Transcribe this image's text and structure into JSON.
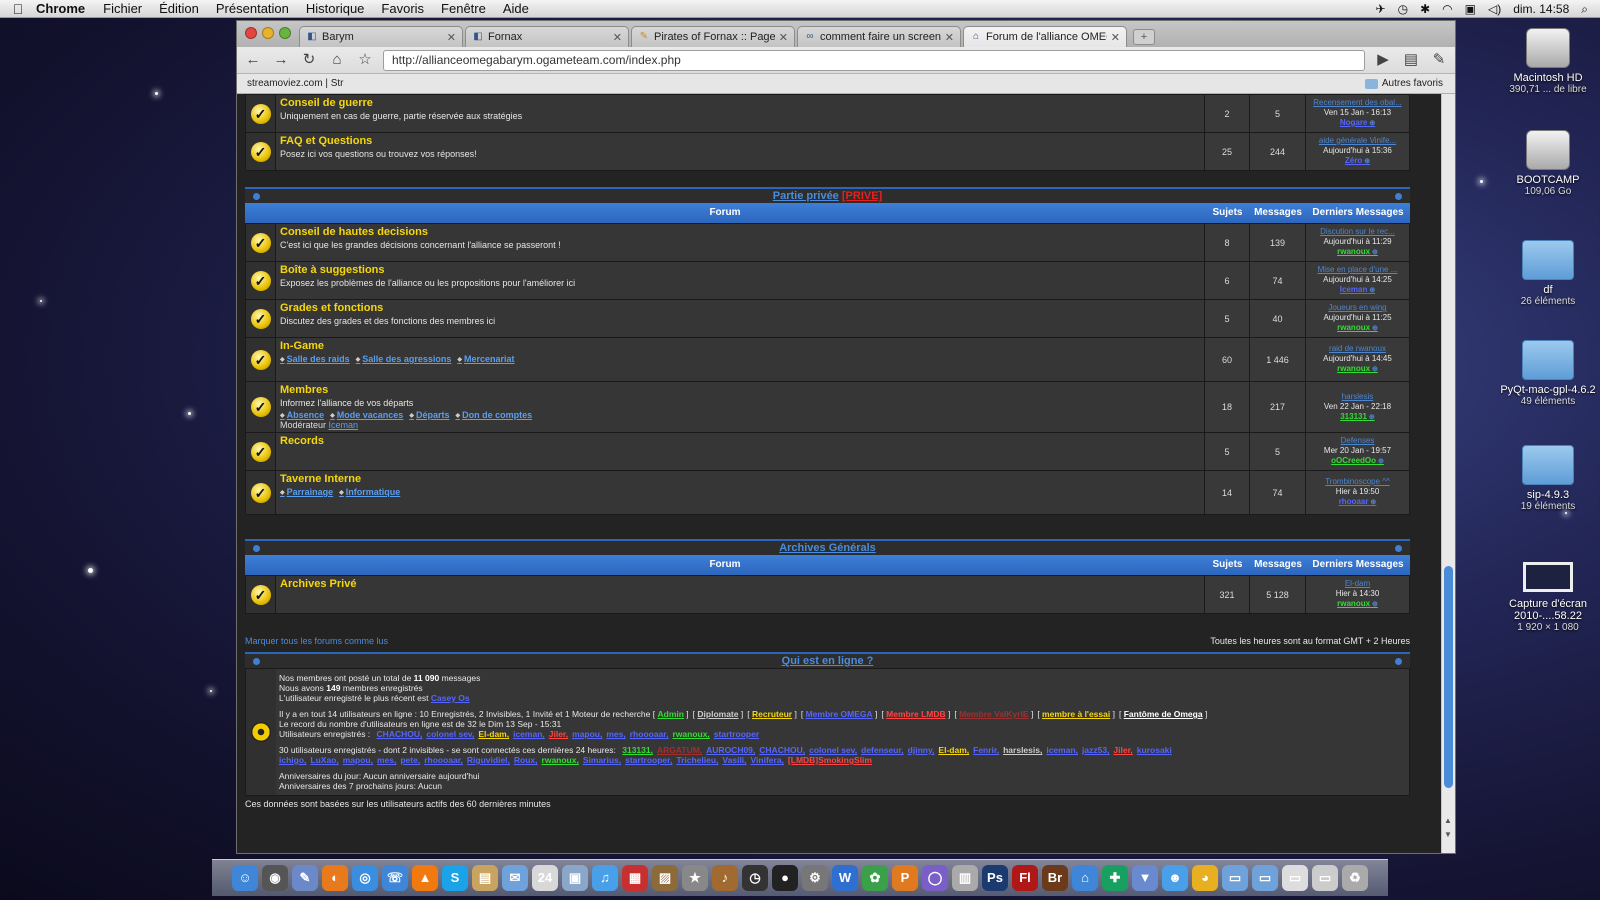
{
  "menubar": {
    "apple": "",
    "app": "Chrome",
    "items": [
      "Fichier",
      "Édition",
      "Présentation",
      "Historique",
      "Favoris",
      "Fenêtre",
      "Aide"
    ],
    "clock": "dim. 14:58"
  },
  "browser": {
    "tabs": [
      {
        "label": "Barym",
        "active": false
      },
      {
        "label": "Fornax",
        "active": false
      },
      {
        "label": "Pirates of Fornax :: Page de l",
        "active": false
      },
      {
        "label": "comment faire un screen sho",
        "active": false
      },
      {
        "label": "Forum de l'alliance OMEGA",
        "active": true
      }
    ],
    "url": "http://allianceomegabarym.ogameteam.com/index.php",
    "bookmark": "streamoviez.com | Str",
    "other_bookmarks": "Autres favoris"
  },
  "forum": {
    "col_forum": "Forum",
    "col_subjects": "Sujets",
    "col_messages": "Messages",
    "col_last": "Derniers Messages",
    "top_rows": [
      {
        "title": "Conseil de guerre",
        "desc": "Uniquement en cas de guerre, partie réservée aux stratégies",
        "subjects": "2",
        "messages": "5",
        "last_topic": "Recensement des obal...",
        "last_date": "Ven 15 Jan - 16:13",
        "last_user": "Nogare",
        "user_color": "#5566ff"
      },
      {
        "title": "FAQ et Questions",
        "desc": "Posez ici vos questions ou trouvez vos réponses!",
        "subjects": "25",
        "messages": "244",
        "last_topic": "aide générale Vinife...",
        "last_date": "Aujourd'hui à 15:36",
        "last_user": "Zéro",
        "user_color": "#5566ff"
      }
    ],
    "private": {
      "name": "Partie privée",
      "tag": "[PRIVE]",
      "rows": [
        {
          "title": "Conseil de hautes decisions",
          "desc": "C'est ici que les grandes décisions concernant l'alliance se passeront !",
          "subjects": "8",
          "messages": "139",
          "last_topic": "Discution sur le rec...",
          "last_date": "Aujourd'hui à 11:29",
          "last_user": "rwanoux",
          "user_color": "#33dd33"
        },
        {
          "title": "Boîte à suggestions",
          "desc": "Exposez les problèmes de l'alliance ou les propositions pour l'améliorer ici",
          "subjects": "6",
          "messages": "74",
          "last_topic": "Mise en place d'une ...",
          "last_date": "Aujourd'hui à 14:25",
          "last_user": "Iceman",
          "user_color": "#5566ff"
        },
        {
          "title": "Grades et fonctions",
          "desc": "Discutez des grades et des fonctions des membres ici",
          "subjects": "5",
          "messages": "40",
          "last_topic": "Joueurs en wing",
          "last_date": "Aujourd'hui à 11:25",
          "last_user": "rwanoux",
          "user_color": "#33dd33"
        },
        {
          "title": "In-Game",
          "desc": "",
          "subforums": [
            "Salle des raids",
            "Salle des agressions",
            "Mercenariat"
          ],
          "subjects": "60",
          "messages": "1 446",
          "last_topic": "raid de rwanoux",
          "last_date": "Aujourd'hui à 14:45",
          "last_user": "rwanoux",
          "user_color": "#33dd33"
        },
        {
          "title": "Membres",
          "desc": "Informez l'alliance de vos départs",
          "subforums": [
            "Absence",
            "Mode vacances",
            "Départs",
            "Don de comptes"
          ],
          "moderator_label": "Modérateur",
          "moderator": "Iceman",
          "subjects": "18",
          "messages": "217",
          "last_topic": "harslesis",
          "last_date": "Ven 22 Jan - 22:18",
          "last_user": "313131",
          "user_color": "#33dd33"
        },
        {
          "title": "Records",
          "desc": "",
          "subjects": "5",
          "messages": "5",
          "last_topic": "Defenses",
          "last_date": "Mer 20 Jan - 19:57",
          "last_user": "oOCreedOo",
          "user_color": "#33dd33"
        },
        {
          "title": "Taverne Interne",
          "desc": "",
          "subforums": [
            "Parrainage",
            "Informatique"
          ],
          "subjects": "14",
          "messages": "74",
          "last_topic": "Trombinoscope ^^",
          "last_date": "Hier à 19:50",
          "last_user": "rhooaar",
          "user_color": "#5566ff"
        }
      ]
    },
    "archives": {
      "name": "Archives Générals",
      "rows": [
        {
          "title": "Archives Privé",
          "desc": "",
          "subjects": "321",
          "messages": "5 128",
          "last_topic": "El-dam",
          "last_date": "Hier à 14:30",
          "last_user": "rwanoux",
          "user_color": "#33dd33"
        }
      ]
    },
    "mark_all": "Marquer tous les forums comme lus",
    "timezone": "Toutes les heures sont au format GMT + 2 Heures"
  },
  "online": {
    "title": "Qui est en ligne ?",
    "stats_1": "Nos membres ont posté un total de",
    "stats_1_num": "11 090",
    "stats_1_end": "messages",
    "stats_2": "Nous avons",
    "stats_2_num": "149",
    "stats_2_end": "membres enregistrés",
    "stats_3": "L'utilisateur enregistré le plus récent est",
    "newest": "Casey Os",
    "users_line": "Il y a en tout 14 utilisateurs en ligne : 10 Enregistrés, 2 Invisibles, 1 Invité et 1 Moteur de recherche",
    "groups": [
      {
        "name": "Admin",
        "color": "#33dd33"
      },
      {
        "name": "Diplomate",
        "color": "#cccccc"
      },
      {
        "name": "Recruteur",
        "color": "#f6d70b"
      },
      {
        "name": "Membre OMEGA",
        "color": "#5566ff"
      },
      {
        "name": "Membre LMDB",
        "color": "#ff4444"
      },
      {
        "name": "Membre VaIKyrIE",
        "color": "#a03030"
      },
      {
        "name": "membre à l'essai",
        "color": "#f6d70b"
      },
      {
        "name": "Fantôme de Omega",
        "color": "#ffffff"
      }
    ],
    "record": "Le record du nombre d'utilisateurs en ligne est de 32 le Dim 13 Sep - 15:31",
    "registered_label": "Utilisateurs enregistrés :",
    "registered": [
      {
        "name": "CHACHOU",
        "color": "#5566ff"
      },
      {
        "name": "colonel sev",
        "color": "#5566ff"
      },
      {
        "name": "El-dam",
        "color": "#f6d70b"
      },
      {
        "name": "iceman",
        "color": "#5566ff"
      },
      {
        "name": "Jiler",
        "color": "#ff4444"
      },
      {
        "name": "mapou",
        "color": "#5566ff"
      },
      {
        "name": "mes",
        "color": "#5566ff"
      },
      {
        "name": "rhoooaar",
        "color": "#5566ff"
      },
      {
        "name": "rwanoux",
        "color": "#33dd33"
      },
      {
        "name": "startrooper",
        "color": "#5566ff"
      }
    ],
    "last24_line": "30 utilisateurs enregistrés - dont 2 invisibles - se sont connectés ces dernières 24 heures:",
    "last24": [
      {
        "name": "313131",
        "color": "#33dd33"
      },
      {
        "name": "ARGATUM",
        "color": "#a03030"
      },
      {
        "name": "AUROCH09",
        "color": "#5566ff"
      },
      {
        "name": "CHACHOU",
        "color": "#5566ff"
      },
      {
        "name": "colonel sev",
        "color": "#5566ff"
      },
      {
        "name": "defenseur",
        "color": "#5566ff"
      },
      {
        "name": "djinny",
        "color": "#5566ff"
      },
      {
        "name": "El-dam",
        "color": "#f6d70b"
      },
      {
        "name": "Fenrir",
        "color": "#5566ff"
      },
      {
        "name": "harslesis",
        "color": "#cccccc"
      },
      {
        "name": "iceman",
        "color": "#5566ff"
      },
      {
        "name": "jazz53",
        "color": "#5566ff"
      },
      {
        "name": "Jiler",
        "color": "#ff4444"
      },
      {
        "name": "kurosaki ichigo",
        "color": "#5566ff"
      },
      {
        "name": "LuXao",
        "color": "#5566ff"
      },
      {
        "name": "mapou",
        "color": "#5566ff"
      },
      {
        "name": "mes",
        "color": "#5566ff"
      },
      {
        "name": "pete",
        "color": "#5566ff"
      },
      {
        "name": "rhoooaar",
        "color": "#5566ff"
      },
      {
        "name": "Riguvidiel",
        "color": "#5566ff"
      },
      {
        "name": "Roux",
        "color": "#5566ff"
      },
      {
        "name": "rwanoux",
        "color": "#33dd33"
      },
      {
        "name": "Simarius",
        "color": "#5566ff"
      },
      {
        "name": "startrooper",
        "color": "#5566ff"
      },
      {
        "name": "Trichelieu",
        "color": "#5566ff"
      },
      {
        "name": "Vasili",
        "color": "#5566ff"
      },
      {
        "name": "Vinifera",
        "color": "#5566ff"
      },
      {
        "name": "[LMDB]SmokingSlim",
        "color": "#ff4444"
      }
    ],
    "birthday_today": "Anniversaires du jour: Aucun anniversaire aujourd'hui",
    "birthday_week": "Anniversaires des 7 prochains jours: Aucun",
    "footer": "Ces données sont basées sur les utilisateurs actifs des 60 dernières minutes"
  },
  "desktop": [
    {
      "name": "Macintosh HD",
      "sub": "390,71 ... de libre",
      "kind": "hd"
    },
    {
      "name": "BOOTCAMP",
      "sub": "109,06 Go",
      "kind": "hd"
    },
    {
      "name": "df",
      "sub": "26 éléments",
      "kind": "folder"
    },
    {
      "name": "PyQt-mac-gpl-4.6.2",
      "sub": "49 éléments",
      "kind": "folder"
    },
    {
      "name": "sip-4.9.3",
      "sub": "19 éléments",
      "kind": "folder"
    },
    {
      "name": "Capture d'écran 2010-....58.22",
      "sub": "1 920 × 1 080",
      "kind": "shot"
    }
  ],
  "dock": [
    {
      "glyph": "☺",
      "color": "#3f86d8"
    },
    {
      "glyph": "◉",
      "color": "#555555"
    },
    {
      "glyph": "✎",
      "color": "#6b88c8"
    },
    {
      "glyph": "◐",
      "color": "#e87a1d"
    },
    {
      "glyph": "◎",
      "color": "#3b8de0"
    },
    {
      "glyph": "☏",
      "color": "#3f86d8"
    },
    {
      "glyph": "▲",
      "color": "#f07a10"
    },
    {
      "glyph": "S",
      "color": "#1aa3e8"
    },
    {
      "glyph": "▤",
      "color": "#c9a460"
    },
    {
      "glyph": "✉",
      "color": "#6fa1da"
    },
    {
      "glyph": "24",
      "color": "#d8d8d8"
    },
    {
      "glyph": "▣",
      "color": "#8aa6c8"
    },
    {
      "glyph": "♫",
      "color": "#4aa0e8"
    },
    {
      "glyph": "▦",
      "color": "#c83030"
    },
    {
      "glyph": "▨",
      "color": "#8c6a3a"
    },
    {
      "glyph": "★",
      "color": "#888888"
    },
    {
      "glyph": "♪",
      "color": "#a06a30"
    },
    {
      "glyph": "◷",
      "color": "#333333"
    },
    {
      "glyph": "●",
      "color": "#222222"
    },
    {
      "glyph": "⚙",
      "color": "#777777"
    },
    {
      "glyph": "W",
      "color": "#2f6fd0"
    },
    {
      "glyph": "✿",
      "color": "#3aa04a"
    },
    {
      "glyph": "P",
      "color": "#e07a20"
    },
    {
      "glyph": "◯",
      "color": "#7a5fc8"
    },
    {
      "glyph": "▥",
      "color": "#aaaaaa"
    },
    {
      "glyph": "Ps",
      "color": "#1a3a70"
    },
    {
      "glyph": "Fl",
      "color": "#b01818"
    },
    {
      "glyph": "Br",
      "color": "#6a3a1a"
    },
    {
      "glyph": "⌂",
      "color": "#3f86d8"
    },
    {
      "glyph": "✚",
      "color": "#18a060"
    },
    {
      "glyph": "▼",
      "color": "#6a8ad0"
    },
    {
      "glyph": "☻",
      "color": "#4aa0e8"
    },
    {
      "glyph": "◕",
      "color": "#e8b020"
    },
    {
      "glyph": "▭",
      "color": "#6fa1da"
    },
    {
      "glyph": "▭",
      "color": "#6fa1da"
    },
    {
      "glyph": "▭",
      "color": "#dddddd"
    },
    {
      "glyph": "▭",
      "color": "#cccccc"
    },
    {
      "glyph": "♻",
      "color": "#aaaaaa"
    }
  ]
}
